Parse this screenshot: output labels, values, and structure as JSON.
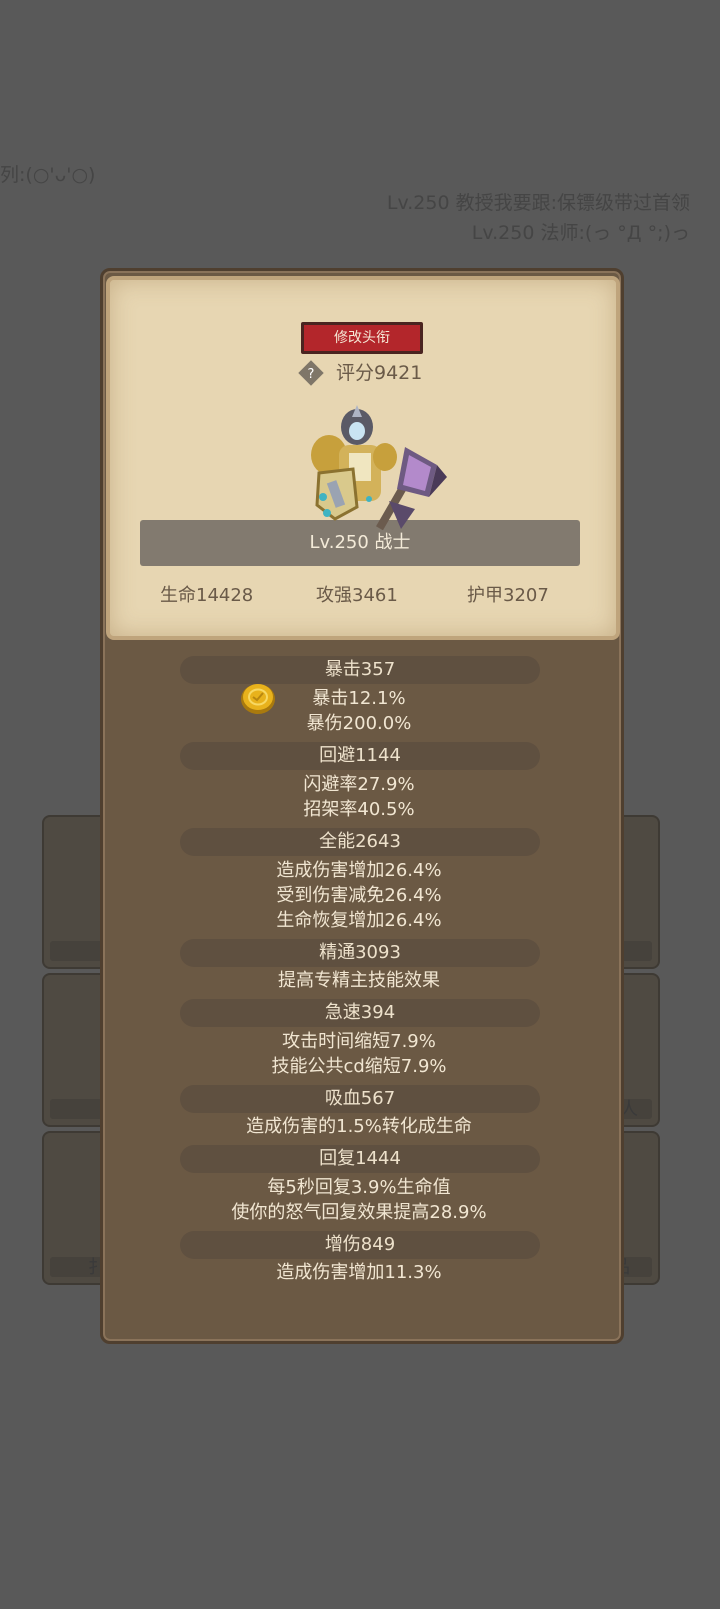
{
  "background": {
    "chat_lines": [
      "列:(○'ᴗ'○)",
      "Lv.250 教授我要跟:保镖级带过首领",
      "Lv.250 法师:(っ °Д °;)っ"
    ],
    "side_labels": [
      "扌",
      "人",
      "品"
    ]
  },
  "card": {
    "title_button": "修改头衔",
    "help_icon": "?",
    "score": "评分9421",
    "level_class": "Lv.250 战士",
    "hp": "生命14428",
    "attack": "攻强3461",
    "armor": "护甲3207"
  },
  "stats": [
    {
      "name": "暴击357",
      "details": [
        "暴击12.1%",
        "暴伤200.0%"
      ]
    },
    {
      "name": "回避1144",
      "details": [
        "闪避率27.9%",
        "招架率40.5%"
      ]
    },
    {
      "name": "全能2643",
      "details": [
        "造成伤害增加26.4%",
        "受到伤害减免26.4%",
        "生命恢复增加26.4%"
      ]
    },
    {
      "name": "精通3093",
      "details": [
        "提高专精主技能效果"
      ]
    },
    {
      "name": "急速394",
      "details": [
        "攻击时间缩短7.9%",
        "技能公共cd缩短7.9%"
      ]
    },
    {
      "name": "吸血567",
      "details": [
        "造成伤害的1.5%转化成生命"
      ]
    },
    {
      "name": "回复1444",
      "details": [
        "每5秒回复3.9%生命值",
        "使你的怒气回复效果提高28.9%"
      ]
    },
    {
      "name": "增伤849",
      "details": [
        "造成伤害增加11.3%"
      ]
    }
  ],
  "colors": {
    "button_red": "#b3262b",
    "coin_gold": "#e8b21c"
  }
}
